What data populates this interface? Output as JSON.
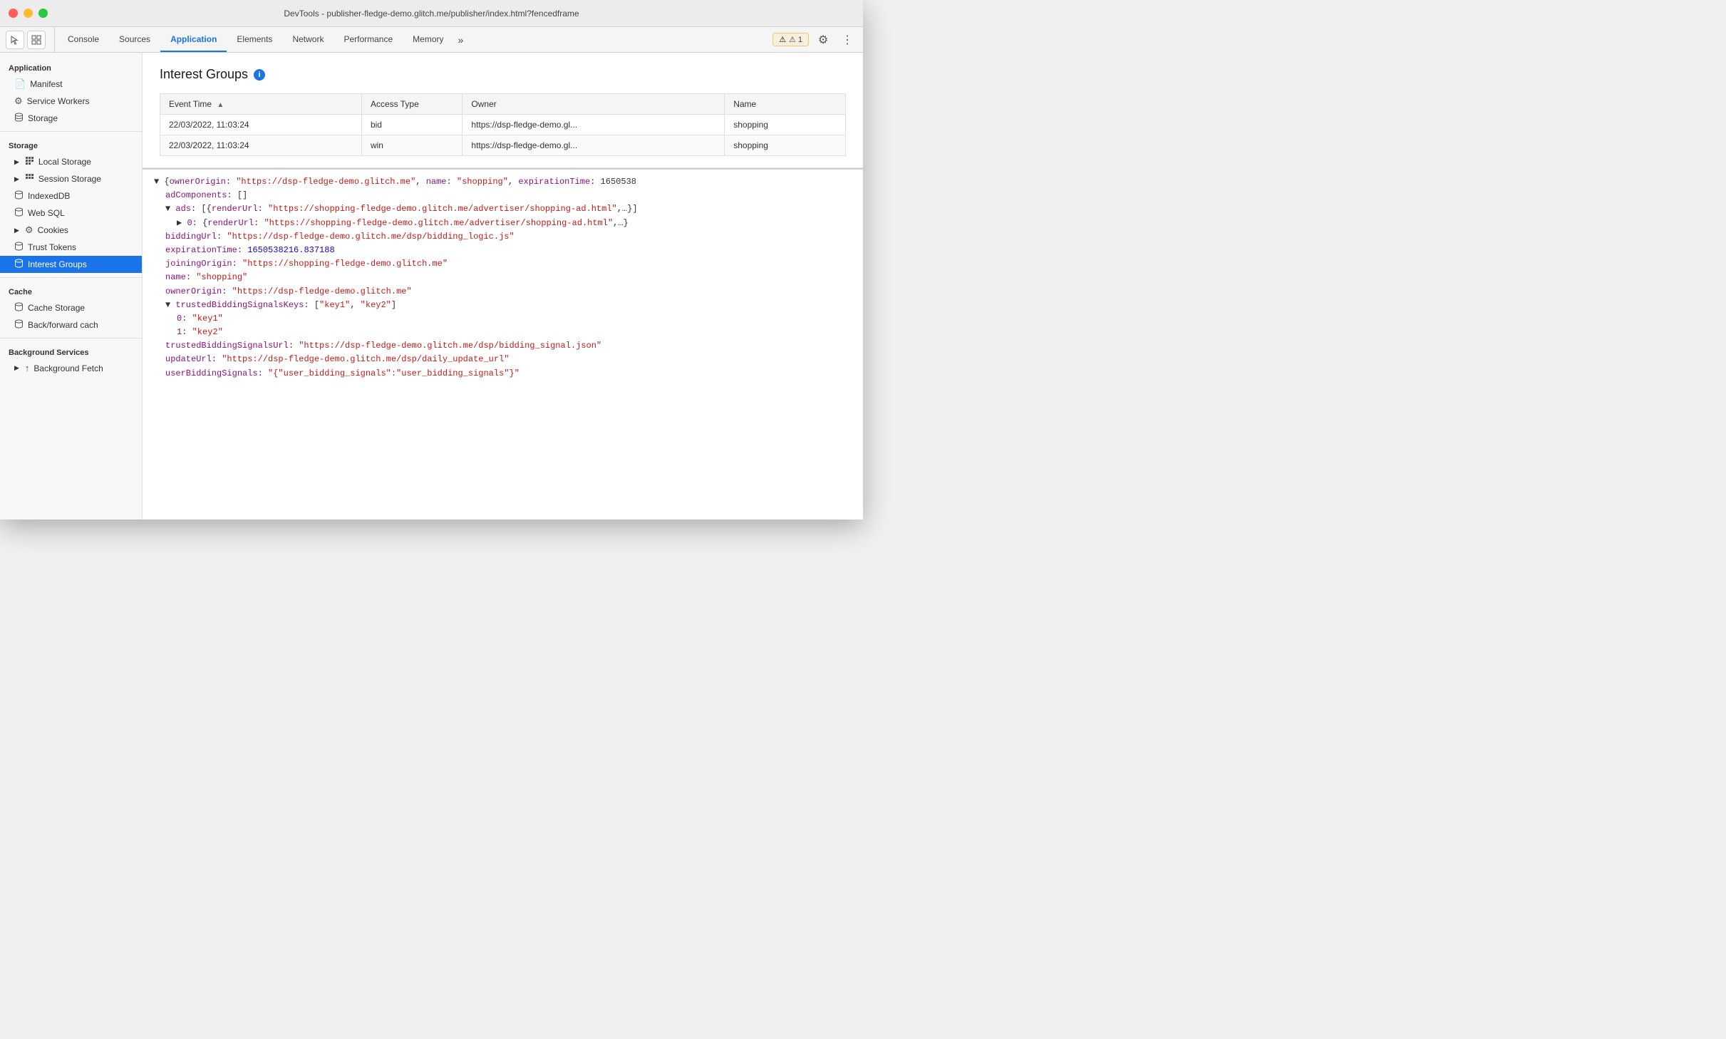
{
  "titleBar": {
    "title": "DevTools - publisher-fledge-demo.glitch.me/publisher/index.html?fencedframe"
  },
  "tabs": {
    "items": [
      {
        "label": "Console",
        "active": false
      },
      {
        "label": "Sources",
        "active": false
      },
      {
        "label": "Application",
        "active": true
      },
      {
        "label": "Elements",
        "active": false
      },
      {
        "label": "Network",
        "active": false
      },
      {
        "label": "Performance",
        "active": false
      },
      {
        "label": "Memory",
        "active": false
      }
    ],
    "more_label": "»",
    "warning_label": "⚠ 1"
  },
  "sidebar": {
    "app_section": "Application",
    "app_items": [
      {
        "label": "Manifest",
        "icon": "📄"
      },
      {
        "label": "Service Workers",
        "icon": "⚙"
      },
      {
        "label": "Storage",
        "icon": "🗄"
      }
    ],
    "storage_section": "Storage",
    "storage_items": [
      {
        "label": "Local Storage",
        "icon": "▶",
        "has_arrow": true
      },
      {
        "label": "Session Storage",
        "icon": "▶",
        "has_arrow": true
      },
      {
        "label": "IndexedDB",
        "icon": "🗄"
      },
      {
        "label": "Web SQL",
        "icon": "🗄"
      },
      {
        "label": "Cookies",
        "icon": "▶",
        "has_arrow": true
      },
      {
        "label": "Trust Tokens",
        "icon": "🗄"
      },
      {
        "label": "Interest Groups",
        "icon": "🗄",
        "active": true
      }
    ],
    "cache_section": "Cache",
    "cache_items": [
      {
        "label": "Cache Storage",
        "icon": "🗄"
      },
      {
        "label": "Back/forward cach",
        "icon": "🗄"
      }
    ],
    "bg_section": "Background Services",
    "bg_items": [
      {
        "label": "Background Fetch",
        "icon": "▶",
        "has_arrow": true
      }
    ]
  },
  "interestGroups": {
    "title": "Interest Groups",
    "table": {
      "columns": [
        "Event Time",
        "Access Type",
        "Owner",
        "Name"
      ],
      "rows": [
        {
          "eventTime": "22/03/2022, 11:03:24",
          "accessType": "bid",
          "owner": "https://dsp-fledge-demo.gl...",
          "name": "shopping"
        },
        {
          "eventTime": "22/03/2022, 11:03:24",
          "accessType": "win",
          "owner": "https://dsp-fledge-demo.gl...",
          "name": "shopping"
        }
      ]
    }
  },
  "jsonDetail": {
    "lines": [
      {
        "indent": 0,
        "content": "▼ {ownerOrigin: \"https://dsp-fledge-demo.glitch.me\", name: \"shopping\", expirationTime: 1650538",
        "type": "mixed"
      },
      {
        "indent": 1,
        "content": "adComponents: []",
        "type": "key-plain"
      },
      {
        "indent": 1,
        "content": "▼ ads: [{renderUrl: \"https://shopping-fledge-demo.glitch.me/advertiser/shopping-ad.html\",…}]",
        "type": "expand"
      },
      {
        "indent": 2,
        "content": "▶ 0: {renderUrl: \"https://shopping-fledge-demo.glitch.me/advertiser/shopping-ad.html\",…}",
        "type": "expand"
      },
      {
        "indent": 1,
        "content": "biddingUrl: \"https://dsp-fledge-demo.glitch.me/dsp/bidding_logic.js\"",
        "type": "key-string"
      },
      {
        "indent": 1,
        "content": "expirationTime: 1650538216.837188",
        "type": "key-number"
      },
      {
        "indent": 1,
        "content": "joiningOrigin: \"https://shopping-fledge-demo.glitch.me\"",
        "type": "key-string"
      },
      {
        "indent": 1,
        "content": "name: \"shopping\"",
        "type": "key-string"
      },
      {
        "indent": 1,
        "content": "ownerOrigin: \"https://dsp-fledge-demo.glitch.me\"",
        "type": "key-string"
      },
      {
        "indent": 1,
        "content": "▼ trustedBiddingSignalsKeys: [\"key1\", \"key2\"]",
        "type": "expand"
      },
      {
        "indent": 2,
        "content": "0: \"key1\"",
        "type": "key-string"
      },
      {
        "indent": 2,
        "content": "1: \"key2\"",
        "type": "key-string"
      },
      {
        "indent": 1,
        "content": "trustedBiddingSignalsUrl: \"https://dsp-fledge-demo.glitch.me/dsp/bidding_signal.json\"",
        "type": "key-string"
      },
      {
        "indent": 1,
        "content": "updateUrl: \"https://dsp-fledge-demo.glitch.me/dsp/daily_update_url\"",
        "type": "key-string"
      },
      {
        "indent": 1,
        "content": "userBiddingSignals: \"{\\\"user_bidding_signals\\\":\\\"user_bidding_signals\\\"}\"",
        "type": "key-string"
      }
    ]
  }
}
